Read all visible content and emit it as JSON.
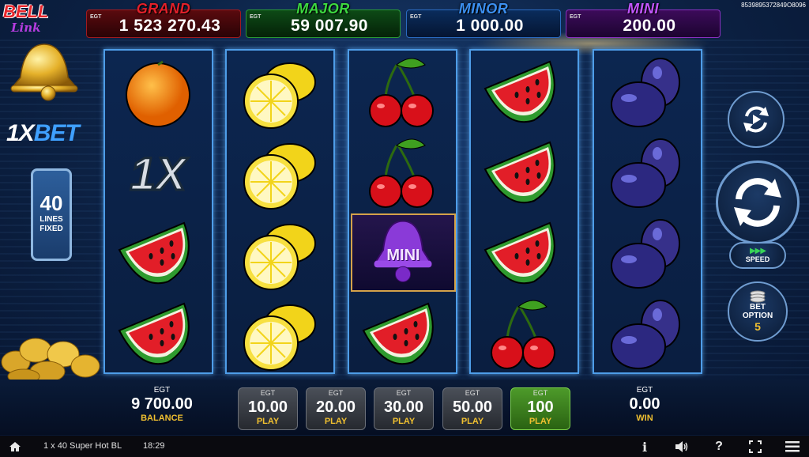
{
  "session_id": "8539895372849O8096",
  "jackpots": {
    "grand": {
      "title": "GRAND",
      "value": "1 523 270.43",
      "provider": "EGT"
    },
    "major": {
      "title": "MAJOR",
      "value": "59 007.90",
      "provider": "EGT"
    },
    "minor": {
      "title": "MINOR",
      "value": "1 000.00",
      "provider": "EGT"
    },
    "mini": {
      "title": "MINI",
      "value": "200.00",
      "provider": "EGT"
    }
  },
  "logo": {
    "line1": "BELL",
    "line2": "Link"
  },
  "brand": {
    "part1": "1X",
    "part2": "BET"
  },
  "lines": {
    "count": "40",
    "label1": "LINES",
    "label2": "FIXED"
  },
  "reels": [
    [
      "orange",
      "1x",
      "watermelon",
      "watermelon"
    ],
    [
      "lemon",
      "lemon",
      "lemon",
      "lemon"
    ],
    [
      "cherry",
      "cherry",
      "mini-bell",
      "watermelon"
    ],
    [
      "watermelon",
      "watermelon",
      "watermelon",
      "cherry"
    ],
    [
      "plum",
      "plum",
      "plum",
      "plum"
    ]
  ],
  "mini_bell_label": "MINI",
  "controls": {
    "speed_label": "SPEED",
    "bet_option_label1": "BET",
    "bet_option_label2": "OPTION",
    "bet_option_value": "5"
  },
  "balance": {
    "provider": "EGT",
    "value": "9 700.00",
    "label": "BALANCE"
  },
  "win": {
    "provider": "EGT",
    "value": "0.00",
    "label": "WIN"
  },
  "bets": [
    {
      "provider": "EGT",
      "value": "10.00",
      "label": "PLAY",
      "active": false
    },
    {
      "provider": "EGT",
      "value": "20.00",
      "label": "PLAY",
      "active": false
    },
    {
      "provider": "EGT",
      "value": "30.00",
      "label": "PLAY",
      "active": false
    },
    {
      "provider": "EGT",
      "value": "50.00",
      "label": "PLAY",
      "active": false
    },
    {
      "provider": "EGT",
      "value": "100",
      "label": "PLAY",
      "active": true
    }
  ],
  "status": {
    "game_name": "1 x 40 Super Hot BL",
    "time": "18:29"
  },
  "icons": [
    "home-icon",
    "info-icon",
    "sound-icon",
    "help-icon",
    "fullscreen-icon",
    "menu-icon"
  ]
}
